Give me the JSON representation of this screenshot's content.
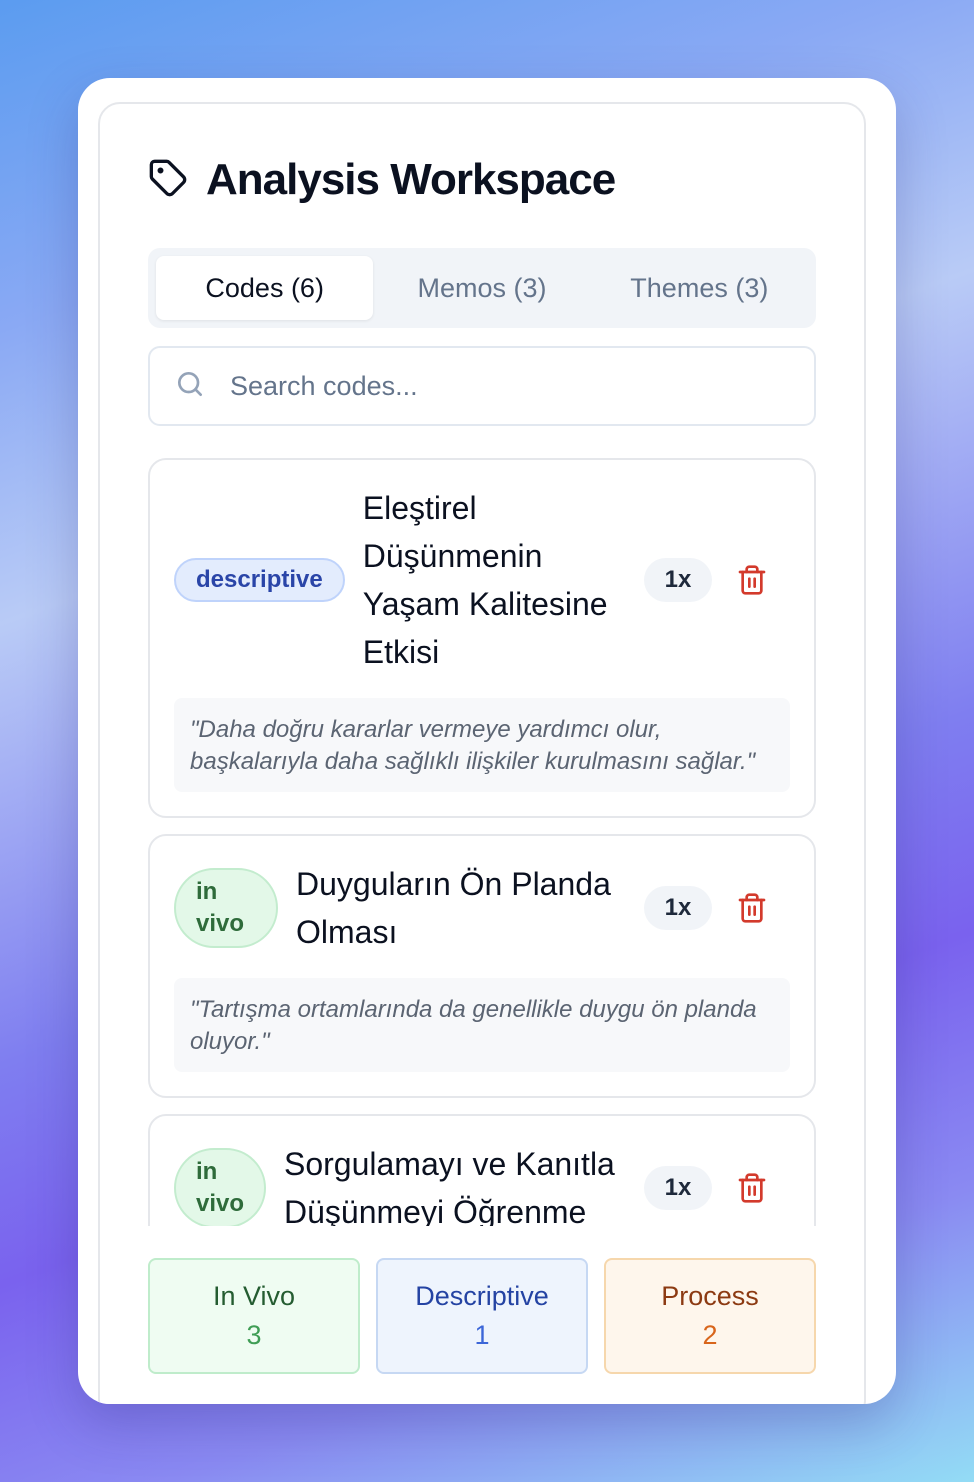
{
  "header": {
    "title": "Analysis Workspace",
    "icon": "tag-icon"
  },
  "tabs": [
    {
      "label": "Codes (6)",
      "active": true
    },
    {
      "label": "Memos (3)",
      "active": false
    },
    {
      "label": "Themes (3)",
      "active": false
    }
  ],
  "search": {
    "placeholder": "Search codes...",
    "value": ""
  },
  "codes": [
    {
      "type": "descriptive",
      "name": "Eleştirel Düşünmenin Yaşam Kalitesine Etkisi",
      "count": "1x",
      "quote": "\"Daha doğru kararlar vermeye yardımcı olur, başkalarıyla daha sağlıklı ilişkiler kurulmasını sağlar.\""
    },
    {
      "type": "in vivo",
      "name": "Duyguların Ön Planda Olması",
      "count": "1x",
      "quote": "\"Tartışma ortamlarında da genellikle duygu ön planda oluyor.\""
    },
    {
      "type": "in vivo",
      "name": "Sorgulamayı ve Kanıtla Düşünmeyi Öğrenme",
      "count": "1x",
      "quote": ""
    }
  ],
  "stats": [
    {
      "label": "In Vivo",
      "value": "3"
    },
    {
      "label": "Descriptive",
      "value": "1"
    },
    {
      "label": "Process",
      "value": "2"
    }
  ],
  "colors": {
    "descriptive": "#2a45a8",
    "in_vivo": "#2e6b3a",
    "process": "#d8651b",
    "trash": "#d33a2c"
  }
}
